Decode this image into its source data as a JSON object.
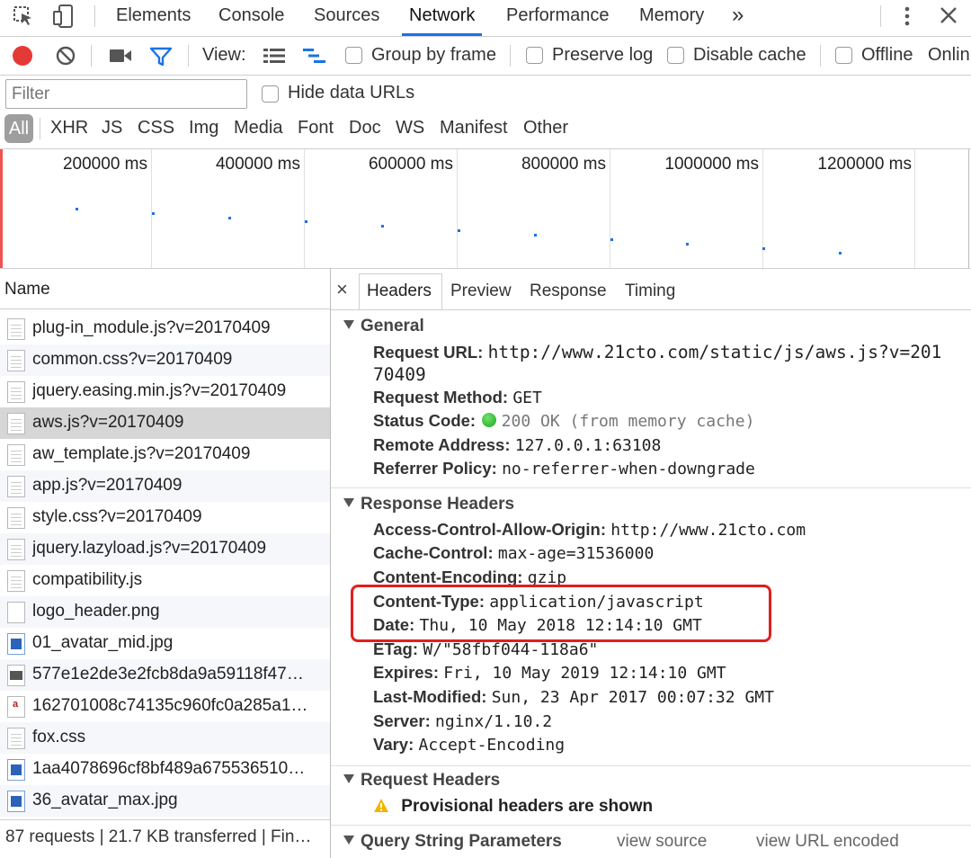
{
  "tabs": [
    "Elements",
    "Console",
    "Sources",
    "Network",
    "Performance",
    "Memory"
  ],
  "tabs_more": "»",
  "toolbar": {
    "view_label": "View:",
    "group_by_frame": "Group by frame",
    "preserve_log": "Preserve log",
    "disable_cache": "Disable cache",
    "offline": "Offline",
    "online": "Onlin"
  },
  "filter": {
    "placeholder": "Filter",
    "hide_data_urls": "Hide data URLs"
  },
  "types": [
    "All",
    "XHR",
    "JS",
    "CSS",
    "Img",
    "Media",
    "Font",
    "Doc",
    "WS",
    "Manifest",
    "Other"
  ],
  "timeline": {
    "ticks": [
      "200000 ms",
      "400000 ms",
      "600000 ms",
      "800000 ms",
      "1000000 ms",
      "1200000 ms"
    ]
  },
  "requests": {
    "header": "Name",
    "items": [
      "plug-in_module.js?v=20170409",
      "common.css?v=20170409",
      "jquery.easing.min.js?v=20170409",
      "aws.js?v=20170409",
      "aw_template.js?v=20170409",
      "app.js?v=20170409",
      "style.css?v=20170409",
      "jquery.lazyload.js?v=20170409",
      "compatibility.js",
      "logo_header.png",
      "01_avatar_mid.jpg",
      "577e1e2de3e2fcb8da9a59118f47…",
      "162701008c74135c960fc0a285a1…",
      "fox.css",
      "1aa4078696cf8bf489a675536510…",
      "36_avatar_max.jpg"
    ],
    "summary": "87 requests | 21.7 KB transferred | Fin…"
  },
  "detail": {
    "close": "×",
    "tabs": [
      "Headers",
      "Preview",
      "Response",
      "Timing"
    ],
    "general": {
      "title": "General",
      "url_key": "Request URL:",
      "url_val_1": "http://www.21cto.com/static/js/aws.js?v=201",
      "url_val_2": "70409",
      "method_key": "Request Method:",
      "method_val": "GET",
      "status_key": "Status Code:",
      "status_val": "200 OK (from memory cache)",
      "remote_key": "Remote Address:",
      "remote_val": "127.0.0.1:63108",
      "referrer_key": "Referrer Policy:",
      "referrer_val": "no-referrer-when-downgrade"
    },
    "response": {
      "title": "Response Headers",
      "rows": [
        {
          "k": "Access-Control-Allow-Origin:",
          "v": "http://www.21cto.com"
        },
        {
          "k": "Cache-Control:",
          "v": "max-age=31536000"
        },
        {
          "k": "Content-Encoding:",
          "v": "gzip"
        },
        {
          "k": "Content-Type:",
          "v": "application/javascript"
        },
        {
          "k": "Date:",
          "v": "Thu, 10 May 2018 12:14:10 GMT"
        },
        {
          "k": "ETag:",
          "v": "W/\"58fbf044-118a6\""
        },
        {
          "k": "Expires:",
          "v": "Fri, 10 May 2019 12:14:10 GMT"
        },
        {
          "k": "Last-Modified:",
          "v": "Sun, 23 Apr 2017 00:07:32 GMT"
        },
        {
          "k": "Server:",
          "v": "nginx/1.10.2"
        },
        {
          "k": "Vary:",
          "v": "Accept-Encoding"
        }
      ]
    },
    "request": {
      "title": "Request Headers",
      "warning": "Provisional headers are shown"
    },
    "query": {
      "title": "Query String Parameters",
      "view_source": "view source",
      "view_url_encoded": "view URL encoded"
    }
  },
  "colors": {
    "record": "#e53935",
    "active_tab": "#1a73e8",
    "highlight_box": "#e0201f",
    "status_dot": "#2ec12e"
  }
}
